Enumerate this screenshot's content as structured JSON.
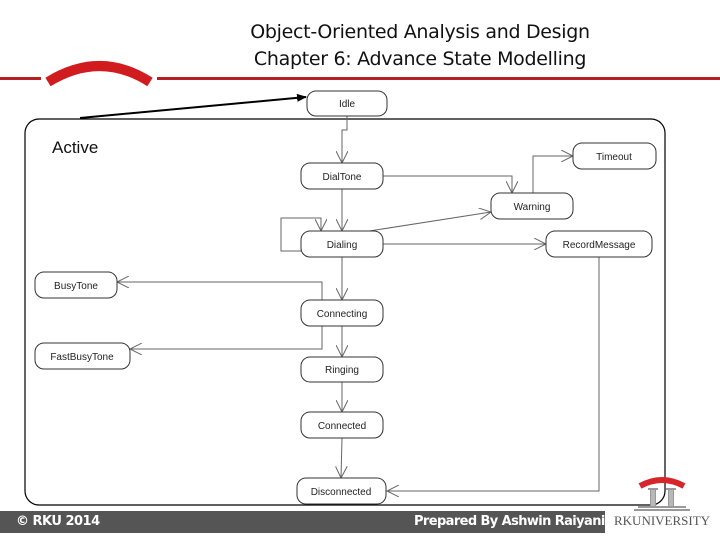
{
  "header": {
    "title_line1": "Object-Oriented Analysis and Design",
    "title_line2": "Chapter 6: Advance State Modelling",
    "accent_color": "#b52025"
  },
  "diagram": {
    "composite_state_label": "Active",
    "states": {
      "idle": "Idle",
      "dialtone": "DialTone",
      "timeout": "Timeout",
      "warning": "Warning",
      "dialing": "Dialing",
      "recordmessage": "RecordMessage",
      "busytone": "BusyTone",
      "connecting": "Connecting",
      "fastbusytone": "FastBusyTone",
      "ringing": "Ringing",
      "connected": "Connected",
      "disconnected": "Disconnected"
    },
    "transitions": [
      {
        "from": "Active",
        "to": "Idle"
      },
      {
        "from": "Idle",
        "to": "DialTone"
      },
      {
        "from": "DialTone",
        "to": "Warning"
      },
      {
        "from": "DialTone",
        "to": "Dialing"
      },
      {
        "from": "Warning",
        "to": "Timeout"
      },
      {
        "from": "Dialing",
        "to": "Dialing"
      },
      {
        "from": "Dialing",
        "to": "Warning"
      },
      {
        "from": "Dialing",
        "to": "RecordMessage"
      },
      {
        "from": "Dialing",
        "to": "Connecting"
      },
      {
        "from": "Connecting",
        "to": "BusyTone"
      },
      {
        "from": "Connecting",
        "to": "FastBusyTone"
      },
      {
        "from": "Connecting",
        "to": "Ringing"
      },
      {
        "from": "Ringing",
        "to": "Connected"
      },
      {
        "from": "Connected",
        "to": "Disconnected"
      },
      {
        "from": "RecordMessage",
        "to": "Disconnected"
      }
    ]
  },
  "footer": {
    "copyright": "© RKU 2014",
    "prepared_by": "Prepared By Ashwin Raiyani",
    "university_name": "RKUNIVERSITY"
  }
}
